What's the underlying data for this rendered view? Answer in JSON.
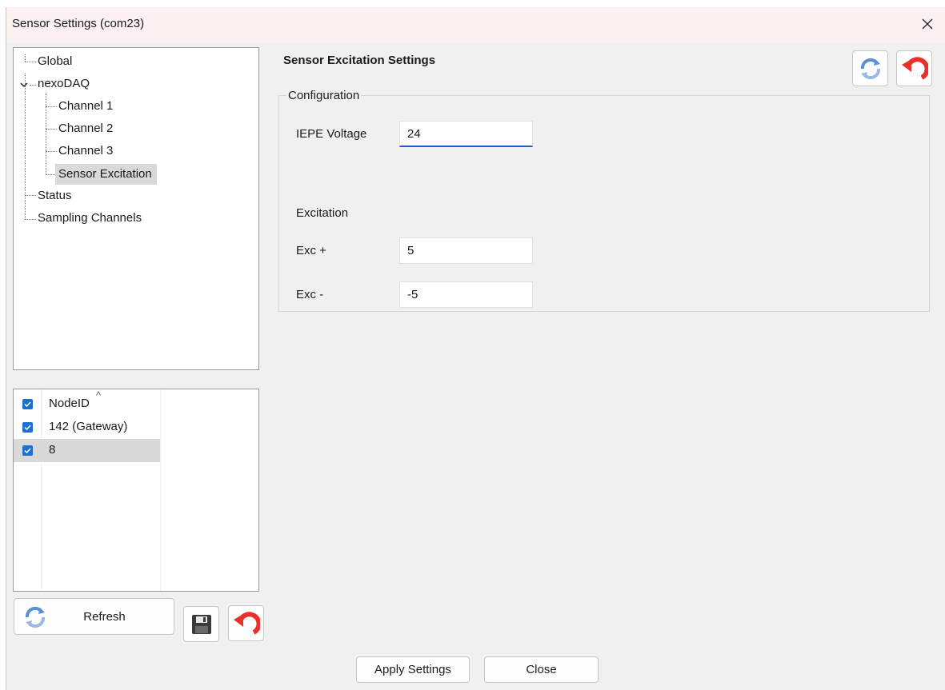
{
  "window": {
    "title": "Sensor Settings (com23)"
  },
  "tree": {
    "items": [
      {
        "label": "Global"
      },
      {
        "label": "nexoDAQ"
      },
      {
        "label": "Channel 1"
      },
      {
        "label": "Channel 2"
      },
      {
        "label": "Channel 3"
      },
      {
        "label": "Sensor Excitation",
        "selected": true
      },
      {
        "label": "Status"
      },
      {
        "label": "Sampling Channels"
      }
    ]
  },
  "nodes": {
    "header": "NodeID",
    "rows": [
      {
        "label": "142 (Gateway)",
        "checked": true
      },
      {
        "label": "8",
        "checked": true,
        "selected": true
      }
    ]
  },
  "left_toolbar": {
    "refresh_label": "Refresh"
  },
  "main": {
    "heading": "Sensor Excitation Settings",
    "group_label": "Configuration",
    "iepe_label": "IEPE Voltage",
    "iepe_value": "24",
    "excitation_label": "Excitation",
    "exc_plus_label": "Exc +",
    "exc_plus_value": "5",
    "exc_minus_label": "Exc -",
    "exc_minus_value": "-5"
  },
  "footer": {
    "apply_label": "Apply Settings",
    "close_label": "Close"
  },
  "colors": {
    "accent": "#1a63c4",
    "checkbox": "#1f6fd0",
    "undo_red": "#e8312a",
    "refresh_blue": "#5b8fd6"
  }
}
